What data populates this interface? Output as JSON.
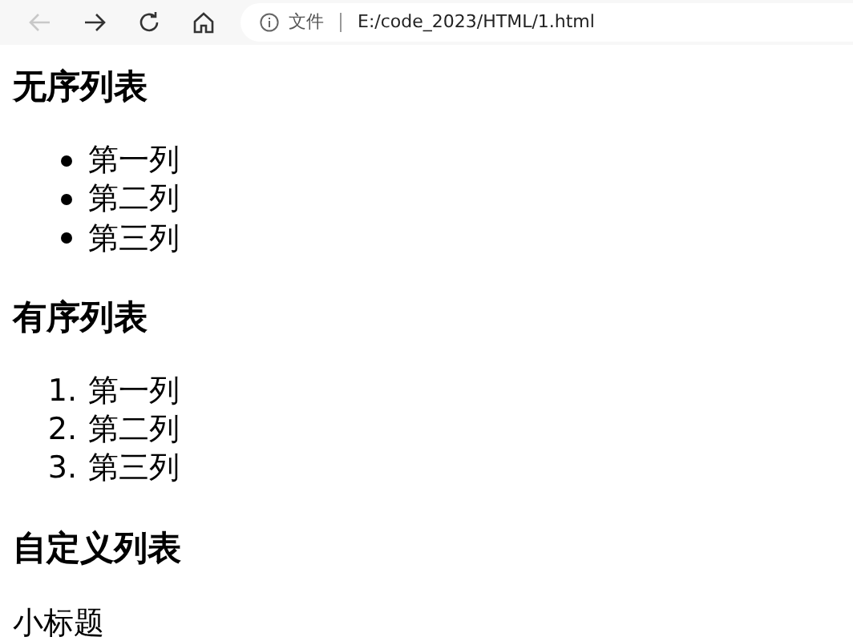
{
  "browser": {
    "back_disabled": true,
    "address_label": "文件",
    "url": "E:/code_2023/HTML/1.html"
  },
  "sections": [
    {
      "heading": "无序列表",
      "kind": "unordered",
      "items": [
        {
          "text": "第一列"
        },
        {
          "text": "第二列"
        },
        {
          "text": "第三列"
        }
      ]
    },
    {
      "heading": "有序列表",
      "kind": "ordered",
      "items": [
        {
          "marker": "1.",
          "text": "第一列"
        },
        {
          "marker": "2.",
          "text": "第二列"
        },
        {
          "marker": "3.",
          "text": "第三列"
        }
      ]
    },
    {
      "heading": "自定义列表",
      "kind": "definition",
      "items": [
        {
          "text": "小标题"
        }
      ]
    }
  ]
}
